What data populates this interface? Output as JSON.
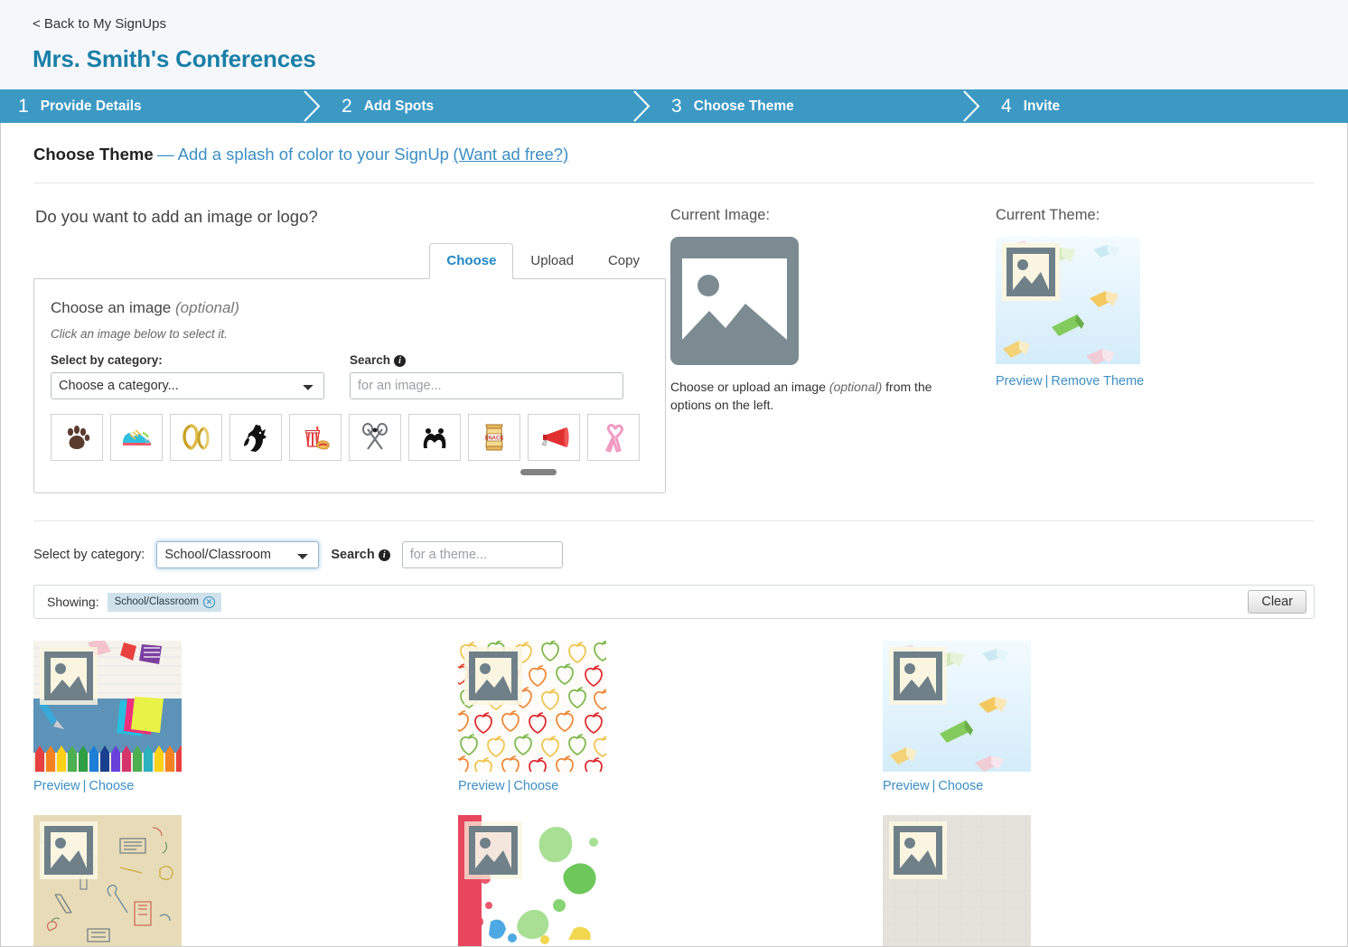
{
  "header": {
    "back_link": "< Back to My SignUps",
    "signup_title": "Mrs. Smith's Conferences"
  },
  "stepper": {
    "steps": [
      {
        "num": "1",
        "label": "Provide Details"
      },
      {
        "num": "2",
        "label": "Add Spots"
      },
      {
        "num": "3",
        "label": "Choose Theme"
      },
      {
        "num": "4",
        "label": "Invite"
      }
    ],
    "active_color": "#3c99c4"
  },
  "section": {
    "title": "Choose Theme",
    "subtitle": "— Add a splash of color to your SignUp",
    "ad_free_link": "(Want ad free?)"
  },
  "image_chooser": {
    "question": "Do you want to add an image or logo?",
    "tabs": [
      {
        "label": "Choose",
        "active": true
      },
      {
        "label": "Upload",
        "active": false
      },
      {
        "label": "Copy",
        "active": false
      }
    ],
    "panel_title": "Choose an image",
    "panel_title_optional": "(optional)",
    "panel_hint": "Click an image below to select it.",
    "category_label": "Select by category:",
    "category_value": "Choose a category...",
    "search_label": "Search",
    "search_placeholder": "for an image...",
    "search_value": "",
    "thumbnails": [
      {
        "name": "paw-print-thumbnail",
        "glyph": "paw"
      },
      {
        "name": "sneaker-thumbnail",
        "glyph": "shoe"
      },
      {
        "name": "horseshoes-thumbnail",
        "glyph": "horseshoe"
      },
      {
        "name": "horse-head-thumbnail",
        "glyph": "horse"
      },
      {
        "name": "concessions-thumbnail",
        "glyph": "drink-hotdog"
      },
      {
        "name": "lacrosse-sticks-thumbnail",
        "glyph": "lacrosse"
      },
      {
        "name": "wrestling-thumbnail",
        "glyph": "wrestlers"
      },
      {
        "name": "snack-bag-thumbnail",
        "glyph": "snack"
      },
      {
        "name": "megaphone-thumbnail",
        "glyph": "megaphone"
      },
      {
        "name": "pink-ribbon-thumbnail",
        "glyph": "ribbon"
      }
    ]
  },
  "current_image": {
    "label": "Current Image:",
    "caption_1": "Choose or upload an image ",
    "caption_optional": "(optional)",
    "caption_2": " from the options on the left."
  },
  "current_theme": {
    "label": "Current Theme:",
    "preview_link": "Preview",
    "separator": "|",
    "remove_link": "Remove Theme"
  },
  "theme_filter": {
    "category_label": "Select by category:",
    "category_value": "School/Classroom",
    "search_label": "Search",
    "search_placeholder": "for a theme...",
    "search_value": "",
    "showing_label": "Showing:",
    "chip_label": "School/Classroom",
    "clear_label": "Clear"
  },
  "themes": {
    "preview_link": "Preview",
    "separator": "|",
    "choose_link": "Choose",
    "items": [
      {
        "name": "theme-school-supplies",
        "style": "supplies",
        "has_links": true
      },
      {
        "name": "theme-apple-pattern",
        "style": "apples",
        "has_links": true
      },
      {
        "name": "theme-floating-books",
        "style": "books",
        "has_links": true
      },
      {
        "name": "theme-doodle-kraft",
        "style": "doodle",
        "has_links": false
      },
      {
        "name": "theme-paint-splatter",
        "style": "splatter",
        "has_links": false
      },
      {
        "name": "theme-plain-texture",
        "style": "plain",
        "has_links": false
      }
    ]
  },
  "colors": {
    "brand_blue": "#1a7fa8",
    "step_blue": "#3c99c4",
    "link_blue": "#3d8fc4",
    "chip_blue": "#cfe2ec",
    "page_bg": "#f5f7fa"
  }
}
